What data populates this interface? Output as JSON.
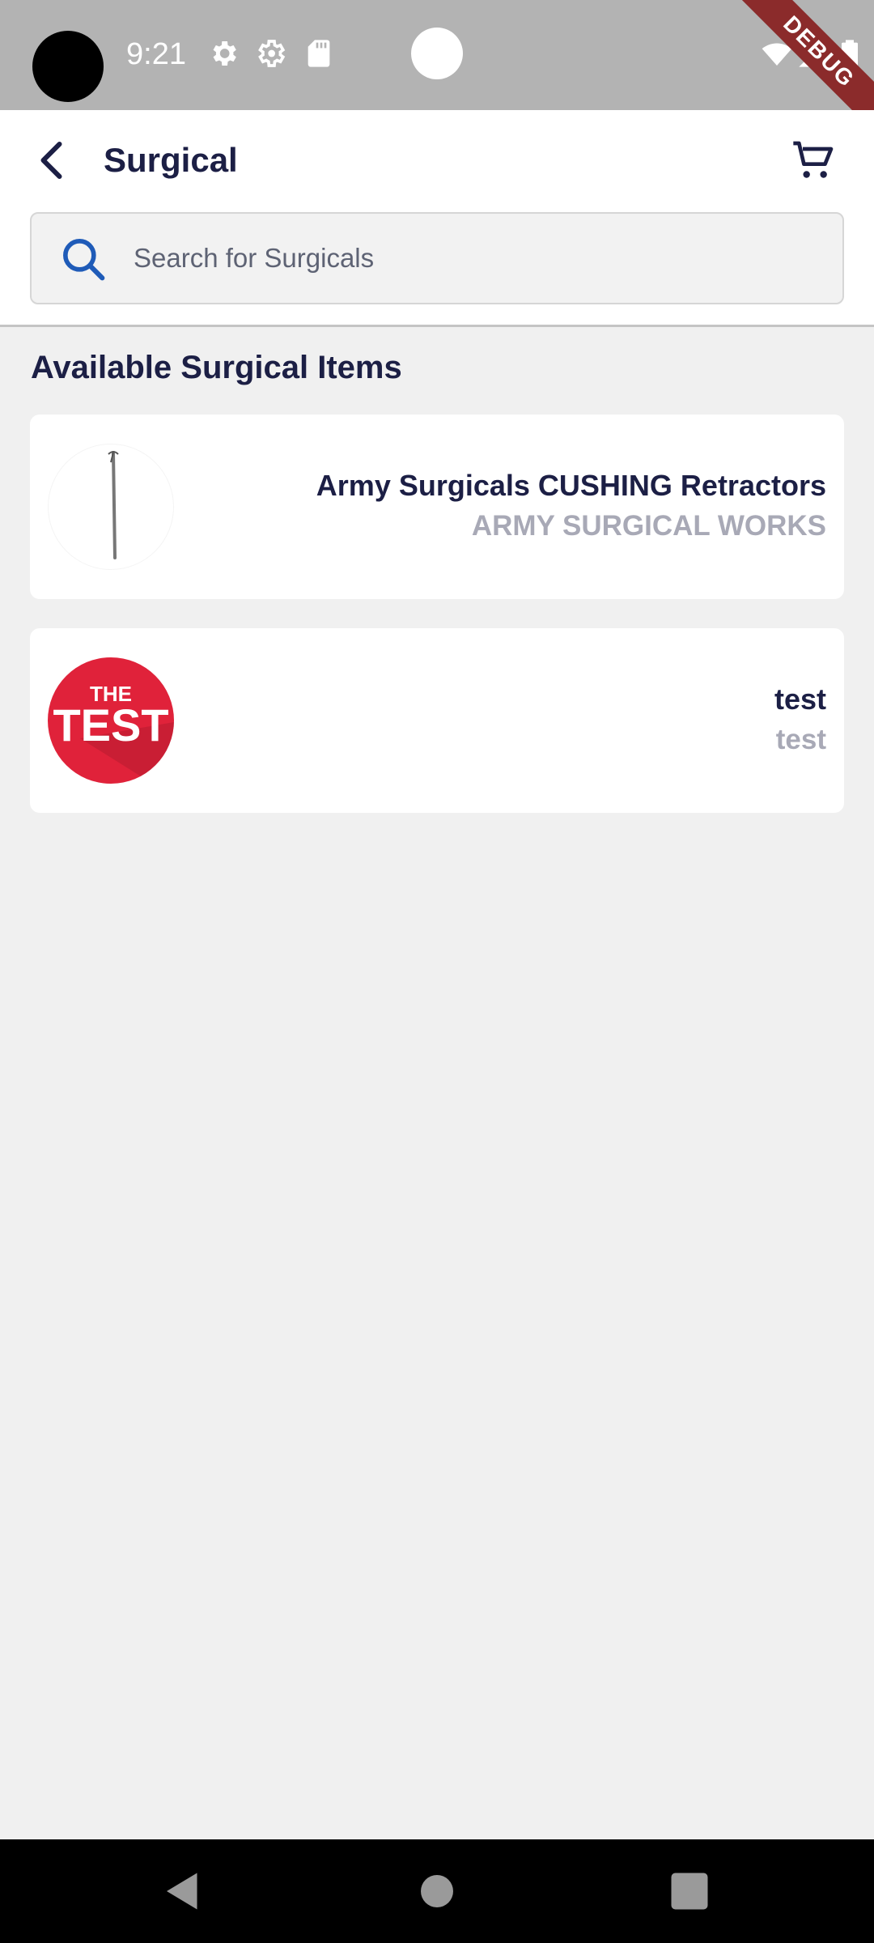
{
  "status_bar": {
    "time": "9:21",
    "debug_label": "DEBUG",
    "icons": [
      "settings-icon",
      "settings-outline-icon",
      "sd-card-icon",
      "wifi-icon",
      "signal-icon",
      "battery-icon"
    ]
  },
  "app_bar": {
    "title": "Surgical",
    "back_icon": "back-arrow-icon",
    "cart_icon": "cart-icon"
  },
  "search": {
    "placeholder": "Search for Surgicals"
  },
  "section": {
    "title": "Available Surgical Items"
  },
  "items": [
    {
      "name": "Army Surgicals CUSHING Retractors",
      "brand": "ARMY SURGICAL WORKS",
      "image_icon": "retractor-image"
    },
    {
      "name": "test",
      "brand": "test",
      "image_icon": "test-logo-image",
      "logo_top": "THE",
      "logo_main": "TEST"
    }
  ],
  "colors": {
    "title": "#1c1f45",
    "subtitle": "#a8a9b6",
    "accent": "#1f5bb8",
    "background": "#f0f0f0"
  }
}
